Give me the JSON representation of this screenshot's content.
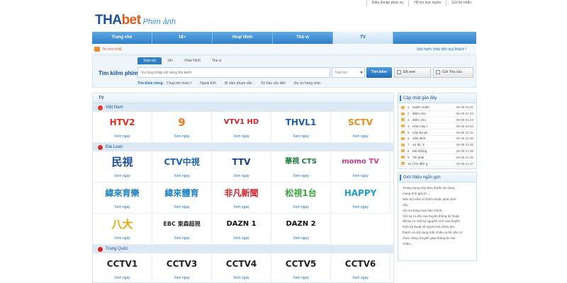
{
  "topbar": [
    "Điều khoản phục vụ",
    "Hỗ trợ trực tuyến",
    "Gửi lời nhắn"
  ],
  "logo": {
    "brand1": "THA",
    "brand2": "bet",
    "sub": "Phim ảnh"
  },
  "nav": [
    "Trang chủ",
    "18+",
    "Hoạt Hình",
    "Thú vị",
    "TV"
  ],
  "notice": {
    "left": "Tin mới nhất",
    "right": "hân hạnh chào đón quý khách !"
  },
  "search": {
    "tabs": [
      "Toàn bộ",
      "18+",
      "Hoạt Hình",
      "Thú vị"
    ],
    "label": "Tìm kiếm phim",
    "placeholder": "Vui lòng nhập nội dung tìm kiếm",
    "select": "Toàn bộ",
    "button": "Tìm kiếm",
    "watched": "Đã xem",
    "request": "Gửi Yêu cầu",
    "quick_label": "Tìm kiếm nóng:",
    "quick": [
      "Chụp lén hoàn t",
      "Ngoại tình",
      "Bị xâm phạm vẫn",
      "Vợ hào sắc đến",
      "Đụ vợ hàng xóm"
    ]
  },
  "content": {
    "title": "TV",
    "watch_label": "Xem ngay",
    "groups": [
      {
        "country": "Việt Nam",
        "flag_color": "#e43a2b",
        "channels": [
          {
            "logo": "HTV2",
            "color": "#e0311f"
          },
          {
            "logo": "9",
            "color": "#f47a20"
          },
          {
            "logo": "VTV1 HD",
            "color": "#d6202a"
          },
          {
            "logo": "THVL1",
            "color": "#1f5ea8"
          },
          {
            "logo": "SCTV",
            "color": "#f08a1c"
          }
        ]
      },
      {
        "country": "Đài Loan",
        "flag_color": "#d92d2d",
        "channels": [
          {
            "logo": "民視",
            "color": "#1d4fa0"
          },
          {
            "logo": "CTV中視",
            "color": "#1b64b5"
          },
          {
            "logo": "TTV",
            "color": "#1a3f8a"
          },
          {
            "logo": "華視 CTS",
            "color": "#1a7a3a"
          },
          {
            "logo": "momo TV",
            "color": "#d23a8c"
          },
          {
            "logo": "緯來育樂",
            "color": "#1a80c4"
          },
          {
            "logo": "緯來體育",
            "color": "#1a80c4"
          },
          {
            "logo": "非凡新聞",
            "color": "#d6202a"
          },
          {
            "logo": "松視1台",
            "color": "#3aa33a"
          },
          {
            "logo": "HAPPY",
            "color": "#1f9bd6"
          },
          {
            "logo": "八大",
            "color": "#e6a700"
          },
          {
            "logo": "EBC 東森超視",
            "color": "#2b2b2b"
          },
          {
            "logo": "DAZN 1",
            "color": "#111111"
          },
          {
            "logo": "DAZN 2",
            "color": "#111111"
          }
        ]
      },
      {
        "country": "Trung Quốc",
        "flag_color": "#e0201a",
        "channels": [
          {
            "logo": "CCTV1",
            "color": "#222222"
          },
          {
            "logo": "CCTV3",
            "color": "#222222"
          },
          {
            "logo": "CCTV4",
            "color": "#222222"
          },
          {
            "logo": "CCTV5",
            "color": "#222222"
          },
          {
            "logo": "CCTV6",
            "color": "#222222"
          }
        ]
      }
    ]
  },
  "updates": {
    "title": "Cập nhật gần đây",
    "rows": [
      {
        "n": "1",
        "title": "Hạnh muốn",
        "date": "09-08 01:51"
      },
      {
        "n": "2",
        "title": "điểm cho",
        "date": "09-08 01:23"
      },
      {
        "n": "3",
        "title": "điểm cho",
        "date": "09-08 01:23"
      },
      {
        "n": "4",
        "title": "Hôm nay t",
        "date": "29-08 23:04"
      },
      {
        "n": "5",
        "title": "Câu bé ph",
        "date": "29-08 22:32"
      },
      {
        "n": "6",
        "title": "Sân trinh",
        "date": "29-08 22:29"
      },
      {
        "n": "7",
        "title": "vợ tôi. Y",
        "date": "29-08 21:48"
      },
      {
        "n": "8",
        "title": "Mẹ không",
        "date": "29-08 21:48"
      },
      {
        "n": "9",
        "title": "Tôi phải",
        "date": "29-08 21:48"
      },
      {
        "n": "10",
        "title": "Cho đến g",
        "date": "29-08 21:47"
      }
    ]
  },
  "intro": {
    "title": "Giới thiệu ngắn gọn",
    "lines": [
      "Trang mạng này đơn thuần sử dụng",
      "mang tính giải trí ...",
      "Nếu hội viên có thích thuộc phim ảnh",
      "này...",
      "Xin vui lòng mua bản chính...",
      "Với sự ra đời của truyền thông kỹ thuật",
      "đã tạo ra một kỷ nguyên mới của truyền",
      "hình kỹ thuật số ngoài trời chiếu âm",
      "thanh và nội dung một chiều ra thì cần có",
      "chức năng chuyển giao thông tin hai",
      "chiều ..."
    ]
  }
}
